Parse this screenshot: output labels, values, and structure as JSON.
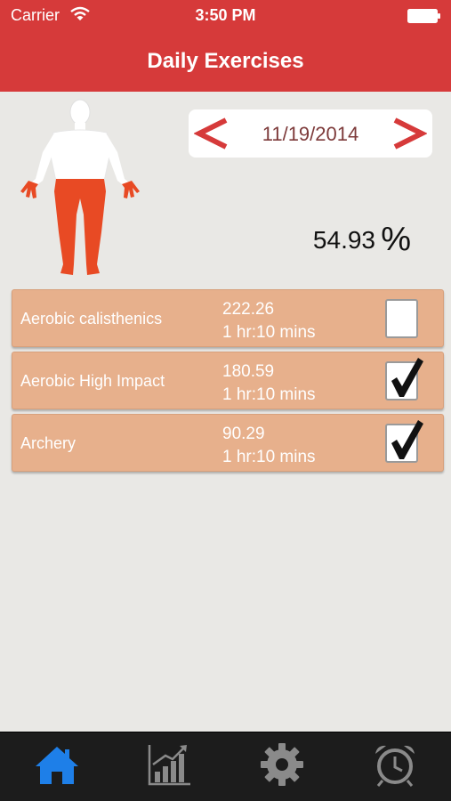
{
  "status_bar": {
    "carrier": "Carrier",
    "time": "3:50 PM"
  },
  "header": {
    "title": "Daily Exercises"
  },
  "date_picker": {
    "date": "11/19/2014",
    "prev_icon": "chevron-left-icon",
    "next_icon": "chevron-right-icon"
  },
  "summary": {
    "percent_value": "54.93",
    "percent_sign": "%"
  },
  "exercises": [
    {
      "name": "Aerobic calisthenics",
      "calories": "222.26",
      "duration": "1 hr:10 mins",
      "checked": false
    },
    {
      "name": "Aerobic High Impact",
      "calories": "180.59",
      "duration": "1 hr:10 mins",
      "checked": true
    },
    {
      "name": "Archery",
      "calories": "90.29",
      "duration": "1 hr:10 mins",
      "checked": true
    }
  ],
  "tab_bar": {
    "items": [
      {
        "icon": "home-icon",
        "active": true
      },
      {
        "icon": "bar-chart-icon",
        "active": false
      },
      {
        "icon": "gear-icon",
        "active": false
      },
      {
        "icon": "alarm-clock-icon",
        "active": false
      }
    ]
  },
  "colors": {
    "header": "#d63a3a",
    "row": "#e7b08c",
    "highlight_body": "#e84a24",
    "tab_active": "#1e7fe8",
    "tab_inactive": "#8a8a8a"
  }
}
